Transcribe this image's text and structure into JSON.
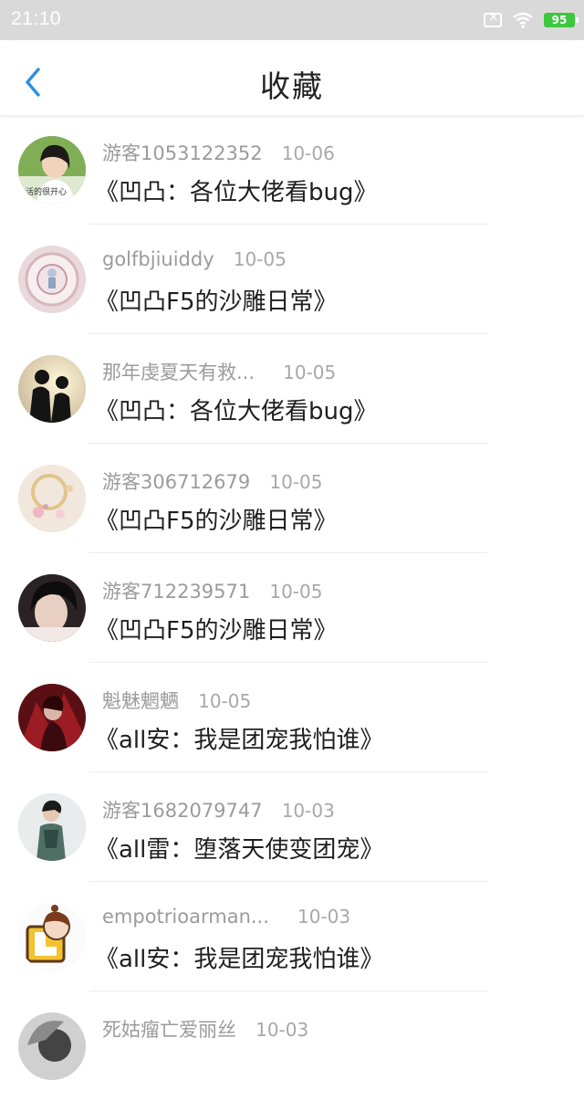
{
  "status": {
    "time": "21:10",
    "battery": "95"
  },
  "header": {
    "title": "收藏"
  },
  "favorites": [
    {
      "username": "游客1053122352",
      "date": "10-06",
      "title": "《凹凸：各位大佬看bug》",
      "avatar_caption": "活的很开心"
    },
    {
      "username": "golfbjiuiddy",
      "date": "10-05",
      "title": "《凹凸F5的沙雕日常》"
    },
    {
      "username": "那年虔夏天有救...",
      "date": "10-05",
      "title": "《凹凸：各位大佬看bug》"
    },
    {
      "username": "游客306712679",
      "date": "10-05",
      "title": "《凹凸F5的沙雕日常》"
    },
    {
      "username": "游客712239571",
      "date": "10-05",
      "title": "《凹凸F5的沙雕日常》"
    },
    {
      "username": "魁魅魍魉",
      "date": "10-05",
      "title": "《all安：我是团宠我怕谁》"
    },
    {
      "username": "游客1682079747",
      "date": "10-03",
      "title": "《all雷：堕落天使变团宠》"
    },
    {
      "username": "empotrioarman...",
      "date": "10-03",
      "title": "《all安：我是团宠我怕谁》"
    },
    {
      "username": "死姑瘤亡爱丽丝",
      "date": "10-03",
      "title": ""
    }
  ]
}
